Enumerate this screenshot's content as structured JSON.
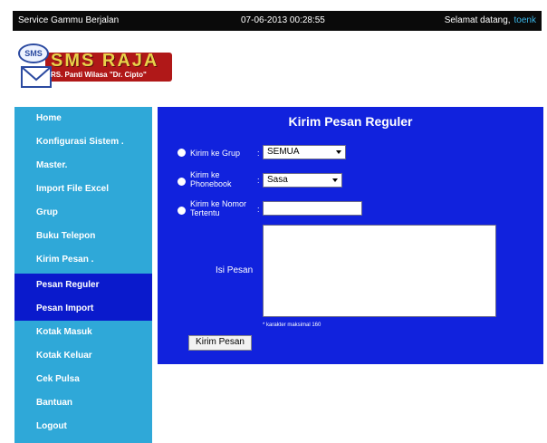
{
  "header": {
    "service_status": "Service Gammu Berjalan",
    "datetime": "07-06-2013 00:28:55",
    "welcome": "Selamat datang,",
    "username": "toenk"
  },
  "logo": {
    "badge": "SMS",
    "brand": "SMS RAJA",
    "subtitle": "RS. Panti Wilasa \"Dr. Cipto\""
  },
  "sidebar": {
    "items": [
      {
        "label": "Home"
      },
      {
        "label": "Konfigurasi Sistem ."
      },
      {
        "label": "Master."
      },
      {
        "label": "Import File Excel"
      },
      {
        "label": "Grup"
      },
      {
        "label": "Buku Telepon"
      },
      {
        "label": "Kirim Pesan ."
      },
      {
        "label": "Pesan Reguler"
      },
      {
        "label": "Pesan Import"
      },
      {
        "label": "Kotak Masuk"
      },
      {
        "label": "Kotak Keluar"
      },
      {
        "label": "Cek Pulsa"
      },
      {
        "label": "Bantuan"
      },
      {
        "label": "Logout"
      }
    ]
  },
  "form": {
    "title": "Kirim Pesan Reguler",
    "option_group_label": "Kirim ke Grup",
    "option_group_value": "SEMUA",
    "option_phonebook_label": "Kirim ke Phonebook",
    "option_phonebook_value": "Sasa",
    "option_number_label": "Kirim ke Nomor Tertentu",
    "option_number_value": "",
    "message_label": "Isi Pesan",
    "message_value": "",
    "note": "* karakter maksimal 160",
    "submit_label": "Kirim Pesan"
  }
}
